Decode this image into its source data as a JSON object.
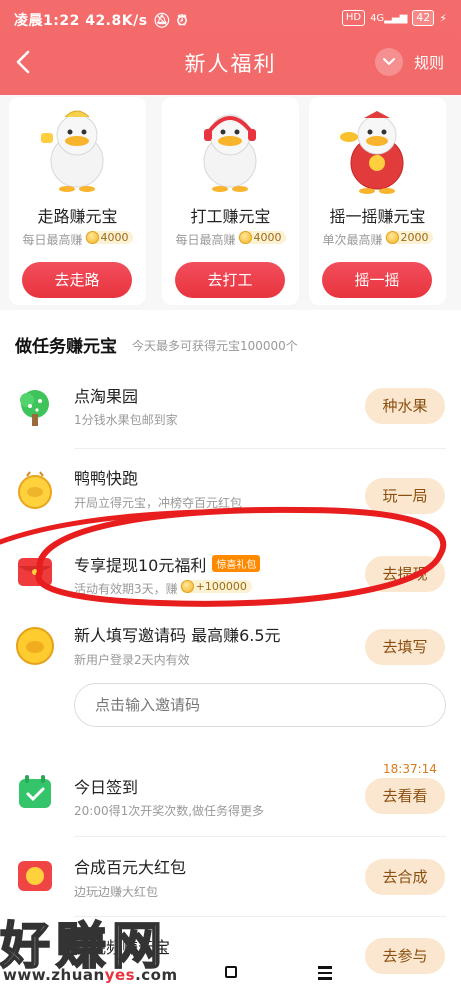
{
  "status_bar": {
    "time": "凌晨1:22",
    "speed": "42.8K/s",
    "hd": "HD",
    "net": "4G",
    "battery": "42"
  },
  "header": {
    "title": "新人福利",
    "rules": "规则"
  },
  "cards": [
    {
      "title": "走路赚元宝",
      "sub": "每日最高赚",
      "amount": "4000",
      "button": "去走路"
    },
    {
      "title": "打工赚元宝",
      "sub": "每日最高赚",
      "amount": "4000",
      "button": "去打工"
    },
    {
      "title": "摇一摇赚元宝",
      "sub": "单次最高赚",
      "amount": "2000",
      "button": "摇一摇"
    }
  ],
  "tasks_section": {
    "title": "做任务赚元宝",
    "subtitle": "今天最多可获得元宝100000个"
  },
  "tasks": [
    {
      "title": "点淘果园",
      "desc": "1分钱水果包邮到家",
      "button": "种水果"
    },
    {
      "title": "鸭鸭快跑",
      "desc": "开局立得元宝，冲榜夺百元红包",
      "button": "玩一局"
    },
    {
      "title": "专享提现10元福利",
      "tag": "惊喜礼包",
      "desc": "活动有效期3天，赚",
      "reward": "+100000",
      "button": "去提现"
    },
    {
      "title": "新人填写邀请码 最高赚6.5元",
      "desc": "新用户登录2天内有效",
      "button": "去填写"
    },
    {
      "title": "今日签到",
      "desc": "20:00得1次开奖次数,做任务得更多",
      "button": "去看看",
      "timer": "18:37:14"
    },
    {
      "title": "合成百元大红包",
      "desc": "边玩边赚大红包",
      "button": "去合成"
    },
    {
      "title": "看视频赚元宝",
      "button": "去参与"
    }
  ],
  "invite_input": {
    "placeholder": "点击输入邀请码"
  },
  "watermark": {
    "text": "好赚网",
    "url_pre": "www.zhuan",
    "url_accent": "yes",
    "url_post": ".com"
  },
  "colors": {
    "header": "#f36a6a",
    "primary_button": "#e8343f",
    "task_button_bg": "#fbe7cf",
    "task_button_text": "#8a4f10"
  }
}
